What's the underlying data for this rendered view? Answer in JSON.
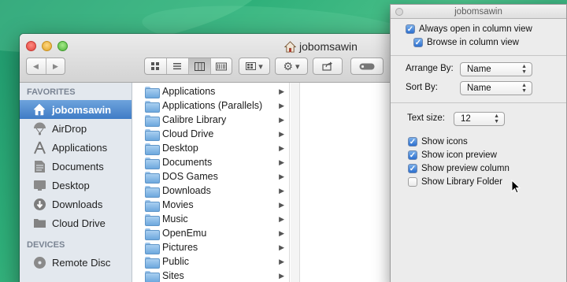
{
  "window": {
    "title": "jobomsawin"
  },
  "toolbar": {
    "back_glyph": "◀",
    "forward_glyph": "▶",
    "gear_glyph": "⚙",
    "dropdown_glyph": "▾"
  },
  "sidebar": {
    "favorites_header": "FAVORITES",
    "devices_header": "DEVICES",
    "favorites": [
      {
        "label": "jobomsawin",
        "icon": "home-icon",
        "selected": true
      },
      {
        "label": "AirDrop",
        "icon": "airdrop-icon"
      },
      {
        "label": "Applications",
        "icon": "applications-icon"
      },
      {
        "label": "Documents",
        "icon": "documents-icon"
      },
      {
        "label": "Desktop",
        "icon": "desktop-icon"
      },
      {
        "label": "Downloads",
        "icon": "downloads-icon"
      },
      {
        "label": "Cloud Drive",
        "icon": "folder-icon"
      }
    ],
    "devices": [
      {
        "label": "Remote Disc",
        "icon": "disc-icon"
      }
    ]
  },
  "column": {
    "items": [
      "Applications",
      "Applications (Parallels)",
      "Calibre Library",
      "Cloud Drive",
      "Desktop",
      "Documents",
      "DOS Games",
      "Downloads",
      "Movies",
      "Music",
      "OpenEmu",
      "Pictures",
      "Public",
      "Sites"
    ],
    "arrow_glyph": "▶"
  },
  "view_options": {
    "title": "jobomsawin",
    "always_open_column": {
      "label": "Always open in column view",
      "checked": true
    },
    "browse_column": {
      "label": "Browse in column view",
      "checked": true
    },
    "arrange_by_label": "Arrange By:",
    "arrange_by_value": "Name",
    "sort_by_label": "Sort By:",
    "sort_by_value": "Name",
    "text_size_label": "Text size:",
    "text_size_value": "12",
    "show_icons": {
      "label": "Show icons",
      "checked": true
    },
    "show_icon_preview": {
      "label": "Show icon preview",
      "checked": true
    },
    "show_preview_column": {
      "label": "Show preview column",
      "checked": true
    },
    "show_library_folder": {
      "label": "Show Library Folder",
      "checked": false
    },
    "check_glyph": "✓"
  },
  "colors": {
    "selection": "#3f7cc6",
    "sidebar_bg": "#e3e8ee",
    "folder_blue": "#6ea8dd"
  }
}
